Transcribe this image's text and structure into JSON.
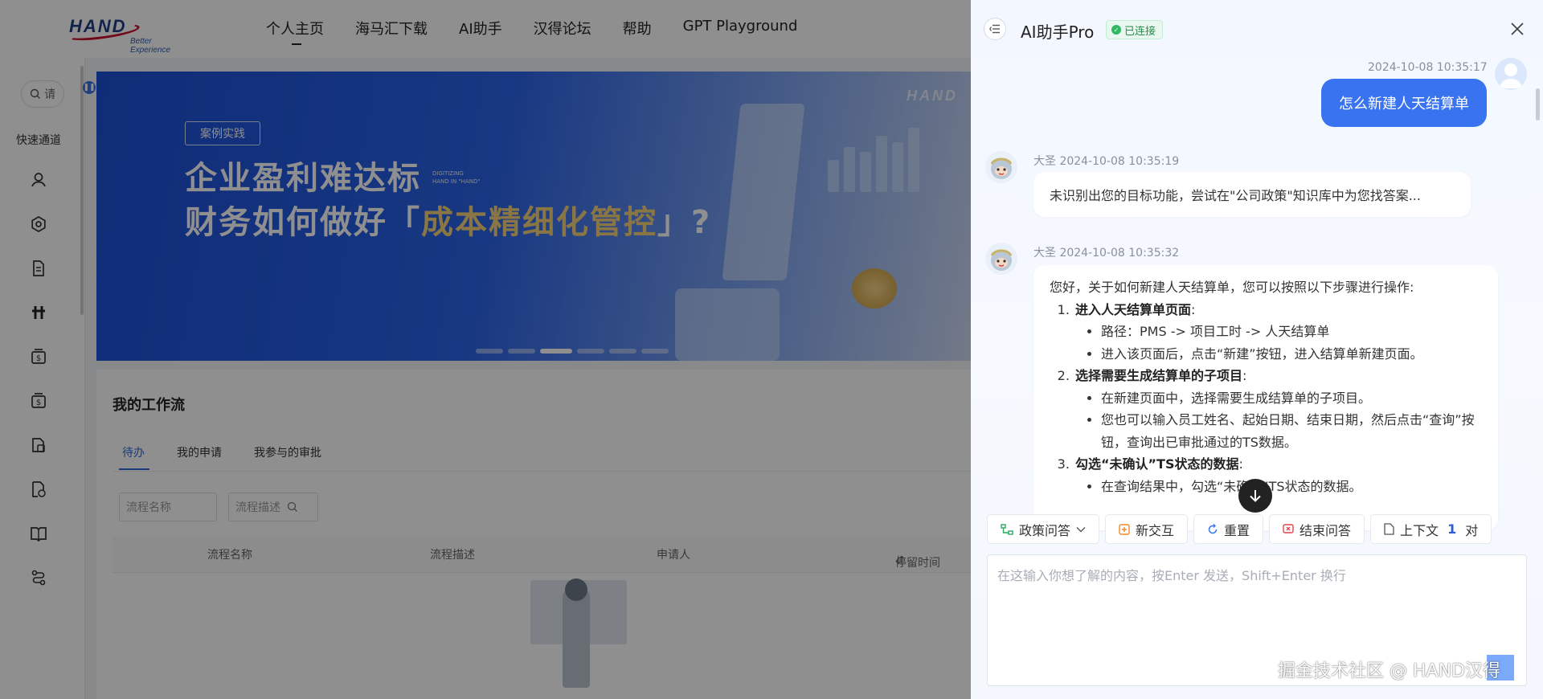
{
  "app": {
    "logo": {
      "main": "HAND",
      "sub": "Better Experience"
    },
    "nav": [
      "个人主页",
      "海马汇下载",
      "AI助手",
      "汉得论坛",
      "帮助",
      "GPT Playground"
    ],
    "sidebar": {
      "search_placeholder": "请",
      "quick_label": "快速通道",
      "icons": [
        "user-icon",
        "gear-icon",
        "document-icon",
        "hash-icon",
        "money-icon",
        "money-icon",
        "folder-doc-icon",
        "doc-clock-icon",
        "book-icon",
        "flow-icon"
      ]
    },
    "banner": {
      "tag": "案例实践",
      "line1": "企业盈利难达标",
      "line2_prefix": "财务如何做好「",
      "line2_highlight": "成本精细化管控",
      "line2_suffix": "」?",
      "mini_text_1": "DIGITIZING",
      "mini_text_2": "HAND IN \"HAND\"",
      "corner_logo": "HAND",
      "active_slide": 3,
      "slide_count": 6
    },
    "workflow": {
      "title": "我的工作流",
      "tabs": [
        "待办",
        "我的申请",
        "我参与的审批"
      ],
      "active_tab": 0,
      "filter_name_placeholder": "流程名称",
      "filter_desc_placeholder": "流程描述",
      "columns": [
        "流程名称",
        "流程描述",
        "申请人",
        "停留时间"
      ]
    }
  },
  "assistant": {
    "title": "AI助手Pro",
    "status": "已连接",
    "messages": {
      "user_time": "2024-10-08 10:35:17",
      "user_text": "怎么新建人天结算单",
      "bot1_meta": "大圣 2024-10-08 10:35:19",
      "bot1_text": "未识别出您的目标功能，尝试在\"公司政策\"知识库中为您找答案...",
      "bot2_meta": "大圣 2024-10-08 10:35:32",
      "bot2_intro": "您好，关于如何新建人天结算单，您可以按照以下步骤进行操作:",
      "steps": [
        {
          "title": "进入人天结算单页面",
          "items": [
            "路径：PMS -> 项目工时 -> 人天结算单",
            "进入该页面后，点击“新建”按钮，进入结算单新建页面。"
          ]
        },
        {
          "title": "选择需要生成结算单的子项目",
          "items": [
            "在新建页面中，选择需要生成结算单的子项目。",
            "您也可以输入员工姓名、起始日期、结束日期，然后点击“查询”按钮，查询出已审批通过的TS数据。"
          ]
        },
        {
          "title": "勾选“未确认”TS状态的数据",
          "items": [
            "在查询结果中，勾选“未确认”TS状态的数据。"
          ]
        }
      ]
    },
    "toolbar": {
      "mode": "政策问答",
      "new_chat": "新交互",
      "reset": "重置",
      "end": "结束问答",
      "context_prefix": "上下文",
      "context_count": "1",
      "context_suffix": "对"
    },
    "input_placeholder": "在这输入你想了解的内容，按Enter 发送，Shift+Enter 换行"
  },
  "watermark": "掘金技术社区 @ HAND汉得",
  "colors": {
    "primary": "#3a73f0",
    "connected": "#2fb764",
    "mask": "rgba(0,0,0,0.44)"
  }
}
